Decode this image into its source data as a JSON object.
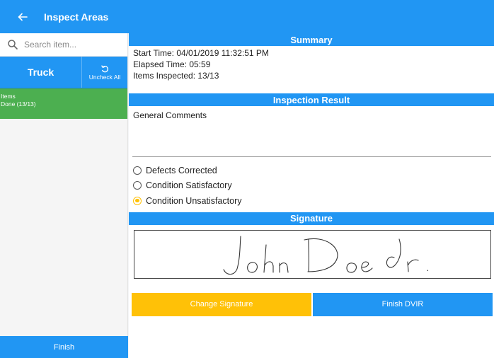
{
  "appbar": {
    "title": "Inspect Areas"
  },
  "sidebar": {
    "search_placeholder": "Search item...",
    "truck_label": "Truck",
    "uncheck_all_label": "Uncheck All",
    "items_title": "Items",
    "items_status": "Done (13/13)",
    "finish_label": "Finish"
  },
  "summary": {
    "header": "Summary",
    "start_time": "Start Time: 04/01/2019 11:32:51 PM",
    "elapsed_time": "Elapsed Time: 05:59",
    "items_inspected": "Items Inspected: 13/13"
  },
  "inspection_result": {
    "header": "Inspection Result",
    "comments_label": "General Comments",
    "options": [
      {
        "label": "Defects Corrected",
        "selected": false
      },
      {
        "label": "Condition Satisfactory",
        "selected": false
      },
      {
        "label": "Condition Unsatisfactory",
        "selected": true
      }
    ]
  },
  "signature": {
    "header": "Signature",
    "signed_name": "John Doe Jr."
  },
  "actions": {
    "change_signature_label": "Change Signature",
    "finish_dvir_label": "Finish DVIR"
  },
  "colors": {
    "primary": "#2196f3",
    "success": "#4caf50",
    "accent": "#ffc107"
  },
  "icons": [
    "back-arrow-icon",
    "search-icon",
    "undo-icon"
  ]
}
